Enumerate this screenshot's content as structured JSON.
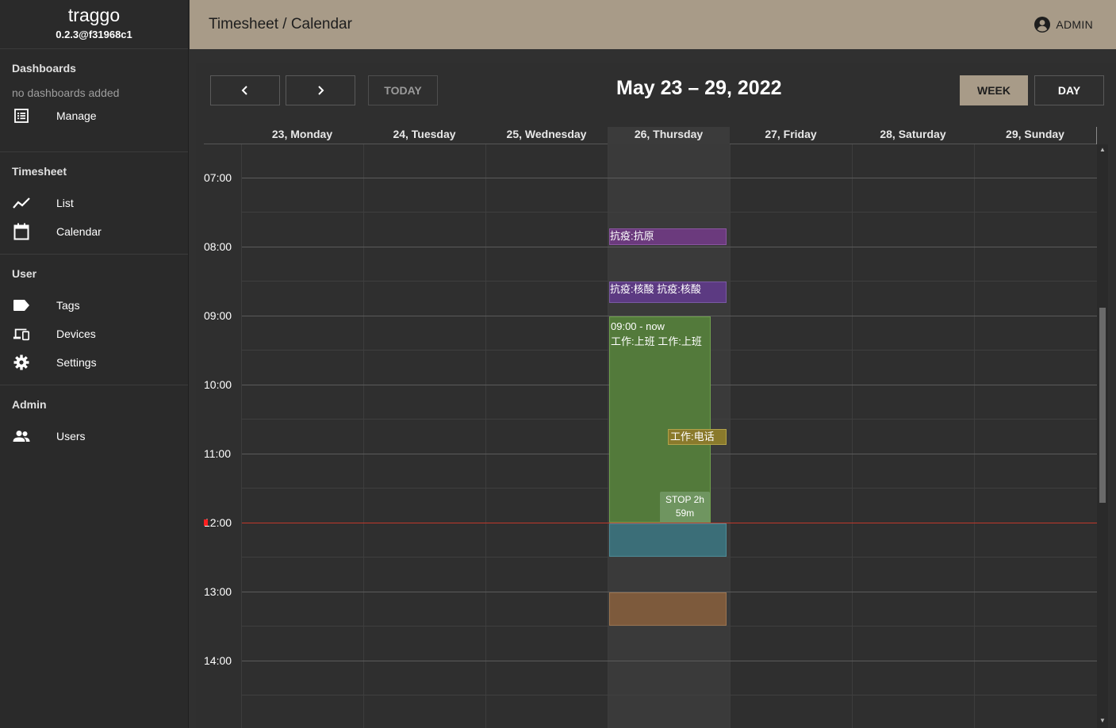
{
  "brand": {
    "name": "traggo",
    "version": "0.2.3@f31968c1"
  },
  "sidebar": {
    "dashboards": {
      "title": "Dashboards",
      "empty": "no dashboards added",
      "manage": "Manage"
    },
    "timesheet": {
      "title": "Timesheet",
      "list": "List",
      "calendar": "Calendar"
    },
    "user": {
      "title": "User",
      "tags": "Tags",
      "devices": "Devices",
      "settings": "Settings"
    },
    "admin": {
      "title": "Admin",
      "users": "Users"
    }
  },
  "header": {
    "title": "Timesheet / Calendar",
    "user": "ADMIN",
    "bar_color": "#a89b88"
  },
  "toolbar": {
    "prev": "‹",
    "next": "›",
    "today": "TODAY",
    "range": "May 23 – 29, 2022",
    "week": "WEEK",
    "day": "DAY",
    "active_view": "WEEK"
  },
  "days": [
    "23, Monday",
    "24, Tuesday",
    "25, Wednesday",
    "26, Thursday",
    "27, Friday",
    "28, Saturday",
    "29, Sunday"
  ],
  "today_index": 3,
  "hours": [
    "07:00",
    "08:00",
    "09:00",
    "10:00",
    "11:00",
    "12:00",
    "13:00",
    "14:00"
  ],
  "events": {
    "e1": "抗疫:抗原",
    "e2": "抗疫:核酸 抗疫:核酸",
    "e3_time": "09:00 - now",
    "e3_tags": "工作:上班 工作:上班",
    "e4": "工作:电话",
    "stop": "STOP 2h 59m"
  }
}
